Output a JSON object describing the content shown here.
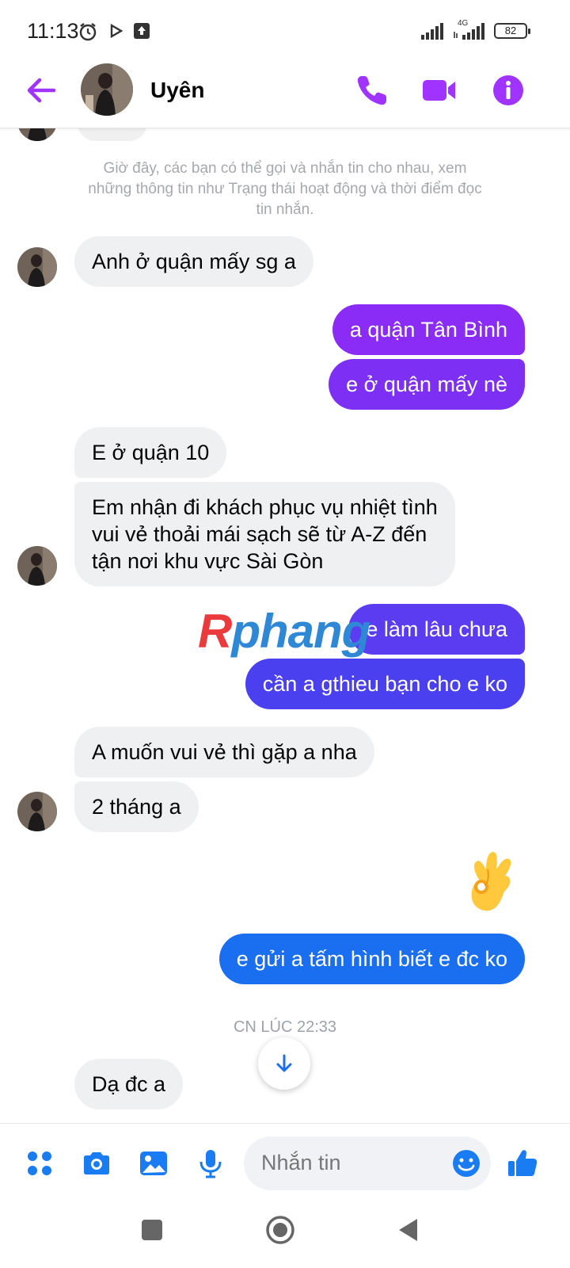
{
  "status_bar": {
    "time": "11:13",
    "network": "4G",
    "battery": "82"
  },
  "header": {
    "contact_name": "Uyên",
    "icons": [
      "back-arrow-icon",
      "phone-icon",
      "video-camera-icon",
      "info-icon"
    ]
  },
  "system_note": "Giờ đây, các bạn có thể gọi và nhắn tin cho nhau, xem những thông tin như Trạng thái hoạt động và thời điểm đọc tin nhắn.",
  "messages": [
    {
      "from": "them",
      "text": "Anh ở quận mấy sg a"
    },
    {
      "from": "me",
      "text": "a quận Tân Bình"
    },
    {
      "from": "me",
      "text": "e ở quận mấy nè"
    },
    {
      "from": "them",
      "text": "E ở quận 10"
    },
    {
      "from": "them",
      "lines": [
        "Em nhận đi khách phục vụ nhiệt tình",
        "vui vẻ thoải mái sạch sẽ từ A-Z đến",
        "tận nơi khu vực Sài Gòn"
      ]
    },
    {
      "from": "me",
      "text": "e làm lâu chưa"
    },
    {
      "from": "me",
      "text": "cần a gthieu bạn cho e ko"
    },
    {
      "from": "them",
      "text": "A muốn vui vẻ thì gặp a nha"
    },
    {
      "from": "them",
      "text": "2 tháng a"
    },
    {
      "from": "me",
      "emoji": "ok-hand-emoji"
    },
    {
      "from": "me",
      "text": "e gửi a tấm hình biết e đc ko"
    },
    {
      "from": "them",
      "text": "Dạ đc a"
    }
  ],
  "timestamp": "CN LÚC 22:33",
  "watermark": {
    "part1": "R",
    "part2": "phang"
  },
  "composer": {
    "placeholder": "Nhắn tin",
    "icons": [
      "menu-grid-icon",
      "camera-icon",
      "gallery-icon",
      "microphone-icon",
      "emoji-icon",
      "thumbs-up-icon"
    ]
  },
  "colors": {
    "accent_purple": "#a033ff",
    "bubble_violet": "#8a2cf5",
    "bubble_indigo": "#5b3cf0",
    "bubble_blue": "#1a6ff0",
    "incoming_bubble": "#eff0f2"
  }
}
